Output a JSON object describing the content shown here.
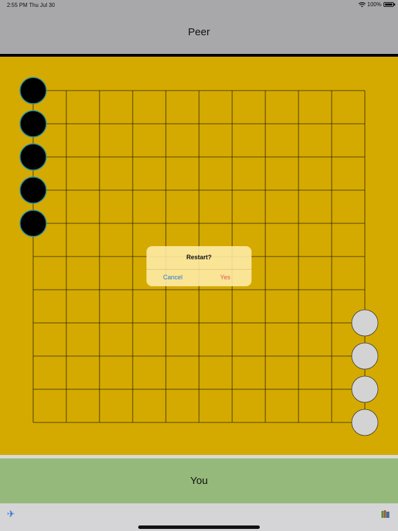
{
  "status_bar": {
    "time": "2:55 PM",
    "date": "Thu Jul 30",
    "battery": "100%",
    "wifi_icon": "wifi-icon",
    "battery_icon": "battery-icon"
  },
  "header": {
    "label": "Peer"
  },
  "footer": {
    "label": "You"
  },
  "board": {
    "rows": 10,
    "cols": 10,
    "background_color": "#d4aa00",
    "peer_stone_color": "#000000",
    "peer_stone_ring": "#2a8fa0",
    "you_stone_color": "#d3d3d3",
    "peer_stones": [
      {
        "col": 0,
        "row": 0
      },
      {
        "col": 0,
        "row": 1
      },
      {
        "col": 0,
        "row": 2
      },
      {
        "col": 0,
        "row": 3
      },
      {
        "col": 0,
        "row": 4
      }
    ],
    "you_stones": [
      {
        "col": 10,
        "row": 7
      },
      {
        "col": 10,
        "row": 8
      },
      {
        "col": 10,
        "row": 9
      },
      {
        "col": 10,
        "row": 10
      }
    ]
  },
  "alert": {
    "title": "Restart?",
    "cancel_label": "Cancel",
    "confirm_label": "Yes",
    "cancel_color": "#1e7bd6",
    "confirm_color": "#e0555b"
  },
  "toolbar": {
    "left_icon": "airplane-icon",
    "right_icon": "books-icon"
  }
}
